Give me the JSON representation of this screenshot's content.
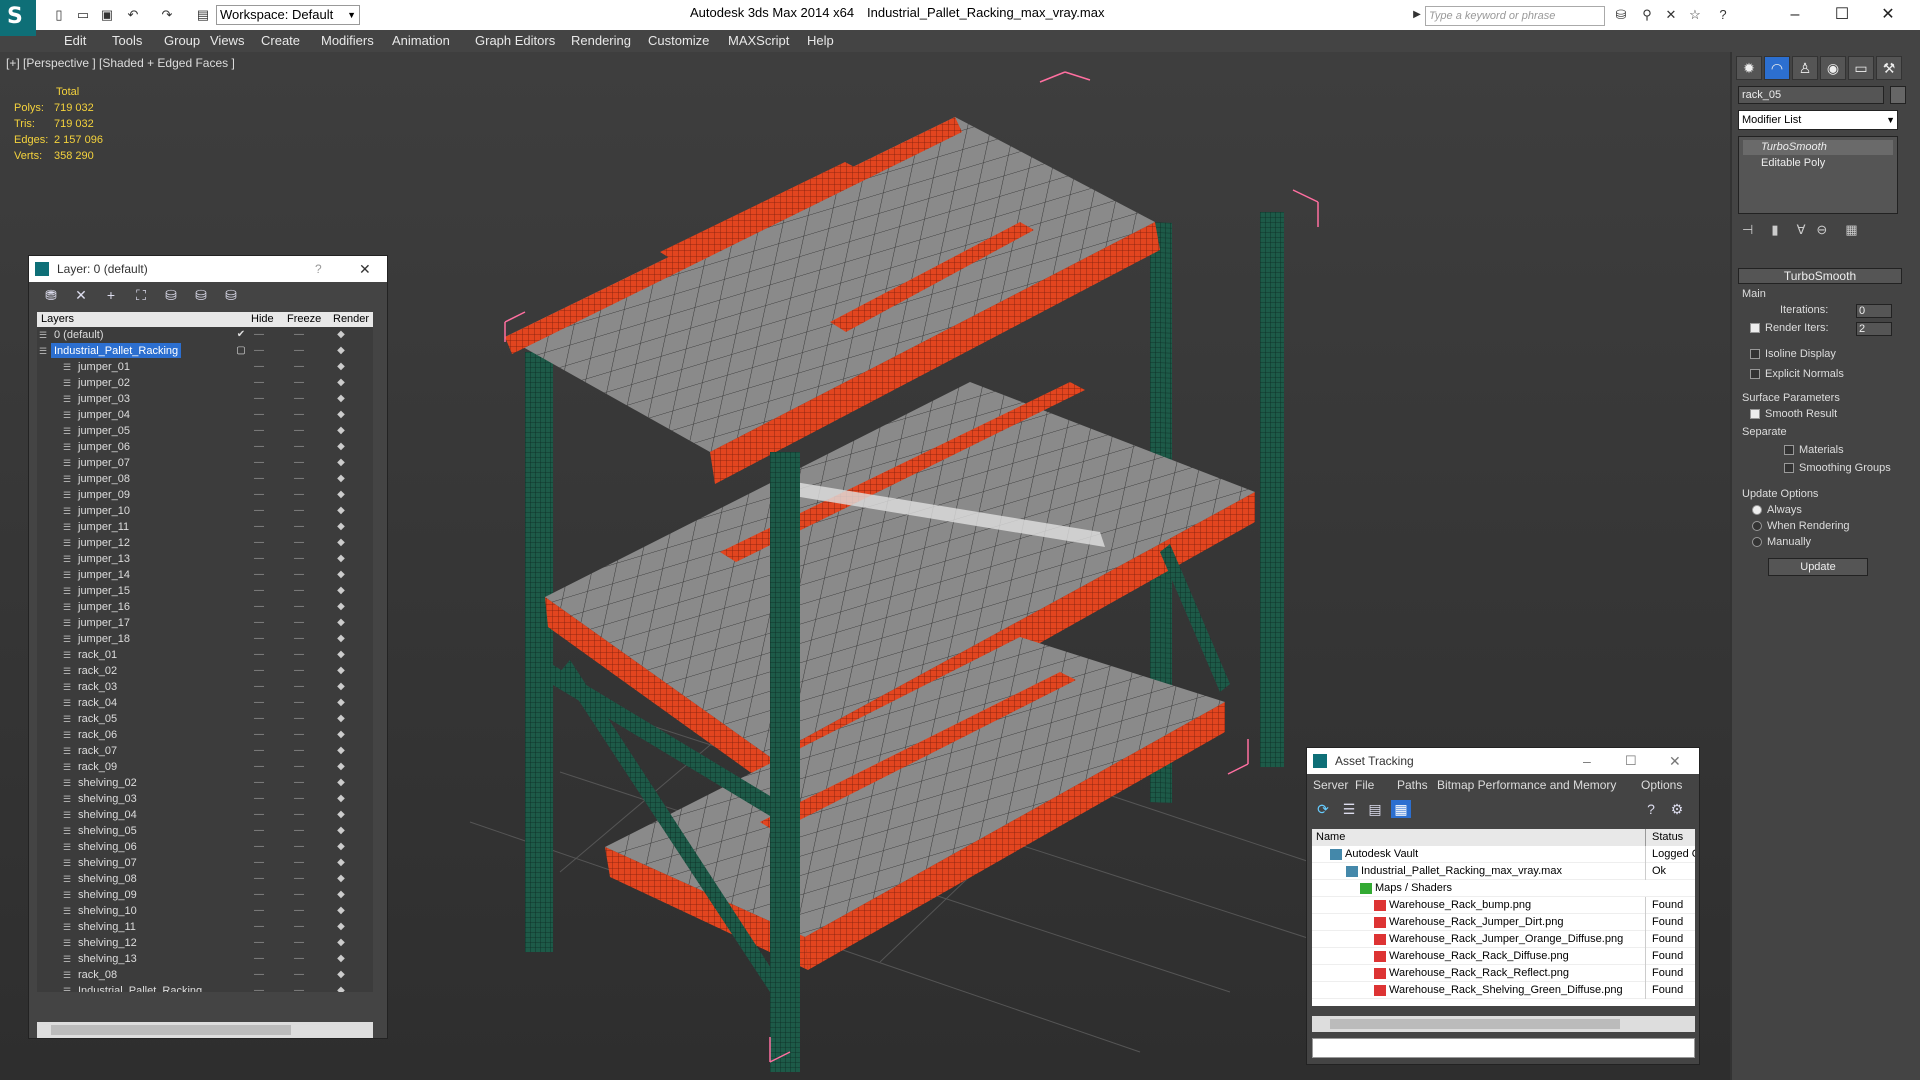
{
  "app": {
    "title": "Autodesk 3ds Max  2014 x64",
    "file": "Industrial_Pallet_Racking_max_vray.max",
    "workspace": "Workspace: Default",
    "search_placeholder": "Type a keyword or phrase"
  },
  "menus": [
    "Edit",
    "Tools",
    "Group",
    "Views",
    "Create",
    "Modifiers",
    "Animation",
    "Graph Editors",
    "Rendering",
    "Customize",
    "MAXScript",
    "Help"
  ],
  "viewport": {
    "label": "[+] [Perspective ] [Shaded + Edged Faces ]",
    "stats_header": "Total",
    "stats": [
      {
        "k": "Polys:",
        "v": "719 032"
      },
      {
        "k": "Tris:",
        "v": "719 032"
      },
      {
        "k": "Edges:",
        "v": "2 157 096"
      },
      {
        "k": "Verts:",
        "v": "358 290"
      }
    ]
  },
  "command_panel": {
    "object_name": "rack_05",
    "modifier_list": "Modifier List",
    "stack": [
      "TurboSmooth",
      "Editable Poly"
    ],
    "rollout": "TurboSmooth",
    "main_group": "Main",
    "iterations_label": "Iterations:",
    "iterations": "0",
    "render_iters_label": "Render Iters:",
    "render_iters": "2",
    "isoline": "Isoline Display",
    "explicit": "Explicit Normals",
    "surface_group": "Surface Parameters",
    "smooth_result": "Smooth Result",
    "separate": "Separate",
    "materials": "Materials",
    "smoothing_groups": "Smoothing Groups",
    "update_group": "Update Options",
    "always": "Always",
    "when_rendering": "When Rendering",
    "manually": "Manually",
    "update_button": "Update"
  },
  "layer_window": {
    "title": "Layer: 0 (default)",
    "help": "?",
    "columns": [
      "Layers",
      "Hide",
      "Freeze",
      "Render"
    ],
    "rows": [
      {
        "name": "0 (default)",
        "indent": 1
      },
      {
        "name": "Industrial_Pallet_Racking",
        "indent": 1,
        "selected": true
      },
      {
        "name": "jumper_01",
        "indent": 2
      },
      {
        "name": "jumper_02",
        "indent": 2
      },
      {
        "name": "jumper_03",
        "indent": 2
      },
      {
        "name": "jumper_04",
        "indent": 2
      },
      {
        "name": "jumper_05",
        "indent": 2
      },
      {
        "name": "jumper_06",
        "indent": 2
      },
      {
        "name": "jumper_07",
        "indent": 2
      },
      {
        "name": "jumper_08",
        "indent": 2
      },
      {
        "name": "jumper_09",
        "indent": 2
      },
      {
        "name": "jumper_10",
        "indent": 2
      },
      {
        "name": "jumper_11",
        "indent": 2
      },
      {
        "name": "jumper_12",
        "indent": 2
      },
      {
        "name": "jumper_13",
        "indent": 2
      },
      {
        "name": "jumper_14",
        "indent": 2
      },
      {
        "name": "jumper_15",
        "indent": 2
      },
      {
        "name": "jumper_16",
        "indent": 2
      },
      {
        "name": "jumper_17",
        "indent": 2
      },
      {
        "name": "jumper_18",
        "indent": 2
      },
      {
        "name": "rack_01",
        "indent": 2
      },
      {
        "name": "rack_02",
        "indent": 2
      },
      {
        "name": "rack_03",
        "indent": 2
      },
      {
        "name": "rack_04",
        "indent": 2
      },
      {
        "name": "rack_05",
        "indent": 2
      },
      {
        "name": "rack_06",
        "indent": 2
      },
      {
        "name": "rack_07",
        "indent": 2
      },
      {
        "name": "rack_09",
        "indent": 2
      },
      {
        "name": "shelving_02",
        "indent": 2
      },
      {
        "name": "shelving_03",
        "indent": 2
      },
      {
        "name": "shelving_04",
        "indent": 2
      },
      {
        "name": "shelving_05",
        "indent": 2
      },
      {
        "name": "shelving_06",
        "indent": 2
      },
      {
        "name": "shelving_07",
        "indent": 2
      },
      {
        "name": "shelving_08",
        "indent": 2
      },
      {
        "name": "shelving_09",
        "indent": 2
      },
      {
        "name": "shelving_10",
        "indent": 2
      },
      {
        "name": "shelving_11",
        "indent": 2
      },
      {
        "name": "shelving_12",
        "indent": 2
      },
      {
        "name": "shelving_13",
        "indent": 2
      },
      {
        "name": "rack_08",
        "indent": 2
      },
      {
        "name": "Industrial_Pallet_Racking",
        "indent": 2
      }
    ]
  },
  "asset_window": {
    "title": "Asset Tracking",
    "menus": [
      "Server",
      "File",
      "Paths",
      "Bitmap Performance and Memory",
      "Options"
    ],
    "columns": [
      "Name",
      "Status"
    ],
    "rows": [
      {
        "name": "Autodesk Vault",
        "status": "Logged Out",
        "indent": 1
      },
      {
        "name": "Industrial_Pallet_Racking_max_vray.max",
        "status": "Ok",
        "indent": 2
      },
      {
        "name": "Maps / Shaders",
        "status": "",
        "indent": 3
      },
      {
        "name": "Warehouse_Rack_bump.png",
        "status": "Found",
        "indent": 4
      },
      {
        "name": "Warehouse_Rack_Jumper_Dirt.png",
        "status": "Found",
        "indent": 4
      },
      {
        "name": "Warehouse_Rack_Jumper_Orange_Diffuse.png",
        "status": "Found",
        "indent": 4
      },
      {
        "name": "Warehouse_Rack_Rack_Diffuse.png",
        "status": "Found",
        "indent": 4
      },
      {
        "name": "Warehouse_Rack_Rack_Reflect.png",
        "status": "Found",
        "indent": 4
      },
      {
        "name": "Warehouse_Rack_Shelving_Green_Diffuse.png",
        "status": "Found",
        "indent": 4
      }
    ]
  },
  "colors": {
    "accent": "#2c6fd0",
    "rack_orange": "#e2451f",
    "rack_green": "#1d5a48",
    "stats": "#f4d23c"
  }
}
